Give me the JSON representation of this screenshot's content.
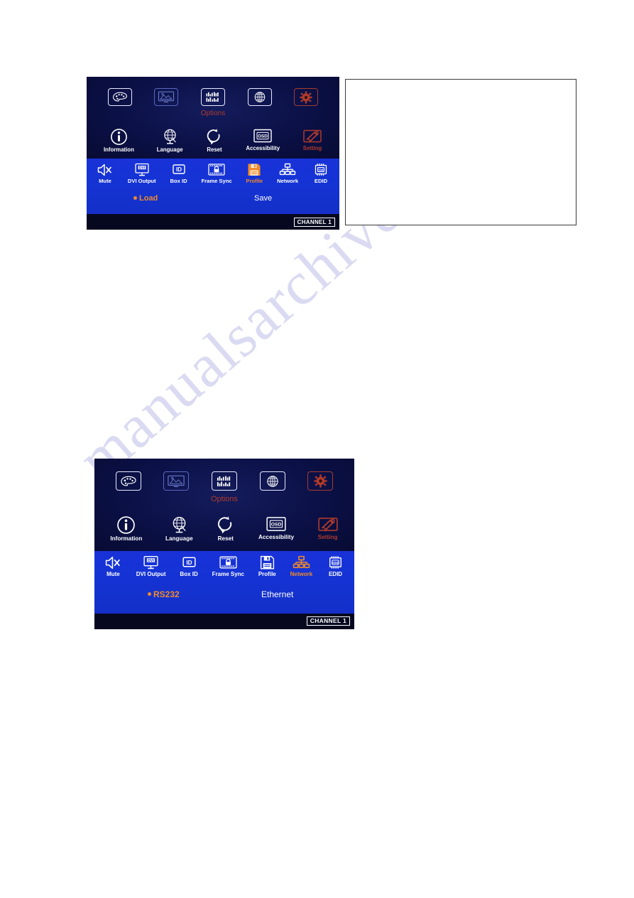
{
  "page": {
    "background_color": "#ffffff",
    "watermark_text": "manualsarchive.com",
    "watermark_color": "#d9d9f2"
  },
  "colors": {
    "osd_dark": "#0a0f3c",
    "osd_band_blue": "#1832d8",
    "label_white": "#ffffff",
    "label_dim": "#6878c8",
    "label_red": "#b03a2c",
    "label_orange": "#f08a2a"
  },
  "osd_panels": [
    {
      "id": "osd-panel-1",
      "top_row": [
        {
          "icon": "color-palette-icon",
          "label": "",
          "state": "normal"
        },
        {
          "icon": "display-picture-icon",
          "label": "",
          "state": "dim"
        },
        {
          "icon": "options-equalizer-icon",
          "label": "Options",
          "state": "selected-red"
        },
        {
          "icon": "globe-network-icon",
          "label": "",
          "state": "normal"
        },
        {
          "icon": "gear-setting-icon",
          "label": "",
          "state": "red"
        }
      ],
      "middle_row": [
        {
          "icon": "information-icon",
          "label": "Information",
          "state": "normal"
        },
        {
          "icon": "language-globe-icon",
          "label": "Language",
          "state": "normal"
        },
        {
          "icon": "reset-icon",
          "label": "Reset",
          "state": "normal"
        },
        {
          "icon": "osd-accessibility-icon",
          "label": "Accessibility",
          "state": "normal"
        },
        {
          "icon": "setting-tools-icon",
          "label": "Setting",
          "state": "red"
        }
      ],
      "bottom_row": [
        {
          "icon": "mute-icon",
          "label": "Mute",
          "state": "normal"
        },
        {
          "icon": "dvi-output-icon",
          "label": "DVI Output",
          "state": "normal"
        },
        {
          "icon": "box-id-icon",
          "label": "Box ID",
          "state": "normal"
        },
        {
          "icon": "frame-sync-lock-icon",
          "label": "Frame Sync",
          "state": "normal"
        },
        {
          "icon": "profile-floppy-icon",
          "label": "Profile",
          "state": "highlighted-orange"
        },
        {
          "icon": "network-icon",
          "label": "Network",
          "state": "normal"
        },
        {
          "icon": "edid-chip-icon",
          "label": "EDID",
          "state": "normal"
        }
      ],
      "sub_options": [
        {
          "label": "Load",
          "selected": true,
          "color": "#f08a2a"
        },
        {
          "label": "Save",
          "selected": false,
          "color": "#ffffff"
        }
      ],
      "channel_badge": "CHANNEL 1"
    },
    {
      "id": "osd-panel-2",
      "top_row": [
        {
          "icon": "color-palette-icon",
          "label": "",
          "state": "normal"
        },
        {
          "icon": "display-picture-icon",
          "label": "",
          "state": "dim"
        },
        {
          "icon": "options-equalizer-icon",
          "label": "Options",
          "state": "selected-red"
        },
        {
          "icon": "globe-network-icon",
          "label": "",
          "state": "normal"
        },
        {
          "icon": "gear-setting-icon",
          "label": "",
          "state": "red"
        }
      ],
      "middle_row": [
        {
          "icon": "information-icon",
          "label": "Information",
          "state": "normal"
        },
        {
          "icon": "language-globe-icon",
          "label": "Language",
          "state": "normal"
        },
        {
          "icon": "reset-icon",
          "label": "Reset",
          "state": "normal"
        },
        {
          "icon": "osd-accessibility-icon",
          "label": "Accessibility",
          "state": "normal"
        },
        {
          "icon": "setting-tools-icon",
          "label": "Setting",
          "state": "red"
        }
      ],
      "bottom_row": [
        {
          "icon": "mute-icon",
          "label": "Mute",
          "state": "normal"
        },
        {
          "icon": "dvi-output-icon",
          "label": "DVI Output",
          "state": "normal"
        },
        {
          "icon": "box-id-icon",
          "label": "Box ID",
          "state": "normal"
        },
        {
          "icon": "frame-sync-lock-icon",
          "label": "Frame Sync",
          "state": "normal"
        },
        {
          "icon": "profile-floppy-icon",
          "label": "Profile",
          "state": "normal"
        },
        {
          "icon": "network-icon",
          "label": "Network",
          "state": "highlighted-orange"
        },
        {
          "icon": "edid-chip-icon",
          "label": "EDID",
          "state": "normal"
        }
      ],
      "sub_options": [
        {
          "label": "RS232",
          "selected": true,
          "color": "#f08a2a"
        },
        {
          "label": "Ethernet",
          "selected": false,
          "color": "#ffffff"
        }
      ],
      "channel_badge": "CHANNEL 1"
    }
  ],
  "side_panel": {
    "name": "empty-white-box",
    "content": ""
  }
}
